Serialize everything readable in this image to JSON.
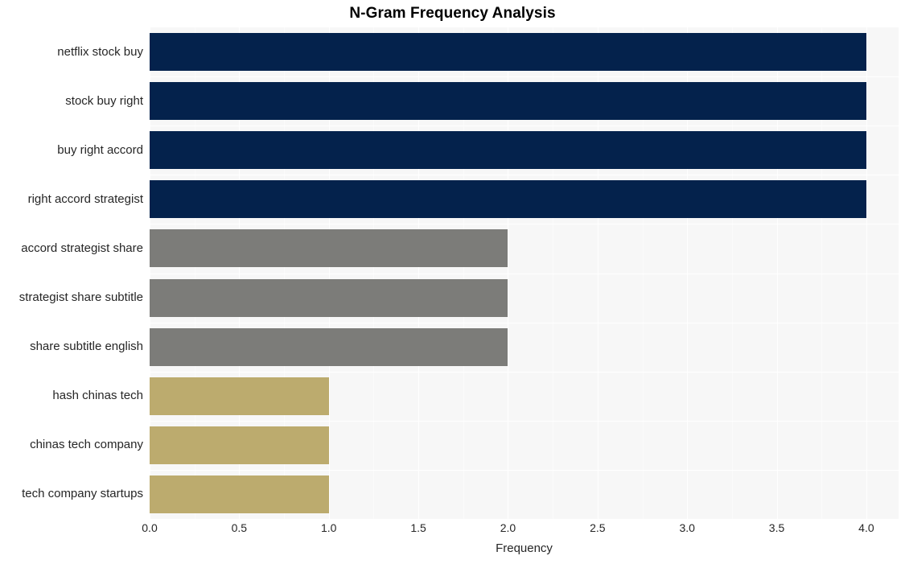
{
  "chart_data": {
    "type": "bar",
    "orientation": "horizontal",
    "title": "N-Gram Frequency Analysis",
    "xlabel": "Frequency",
    "ylabel": "",
    "xlim": [
      0,
      4.18
    ],
    "xticks": [
      "0.0",
      "0.5",
      "1.0",
      "1.5",
      "2.0",
      "2.5",
      "3.0",
      "3.5",
      "4.0"
    ],
    "xtick_values": [
      0.0,
      0.5,
      1.0,
      1.5,
      2.0,
      2.5,
      3.0,
      3.5,
      4.0
    ],
    "grid": true,
    "legend": "none",
    "categories": [
      "netflix stock buy",
      "stock buy right",
      "buy right accord",
      "right accord strategist",
      "accord strategist share",
      "strategist share subtitle",
      "share subtitle english",
      "hash chinas tech",
      "chinas tech company",
      "tech company startups"
    ],
    "values": [
      4,
      4,
      4,
      4,
      2,
      2,
      2,
      1,
      1,
      1
    ],
    "bar_colors": [
      "#04224c",
      "#04224c",
      "#04224c",
      "#04224c",
      "#7c7c79",
      "#7c7c79",
      "#7c7c79",
      "#bcab6e",
      "#bcab6e",
      "#bcab6e"
    ],
    "plot_background": "#f7f7f7",
    "grid_color": "#ffffff",
    "text_color": "#262626"
  }
}
